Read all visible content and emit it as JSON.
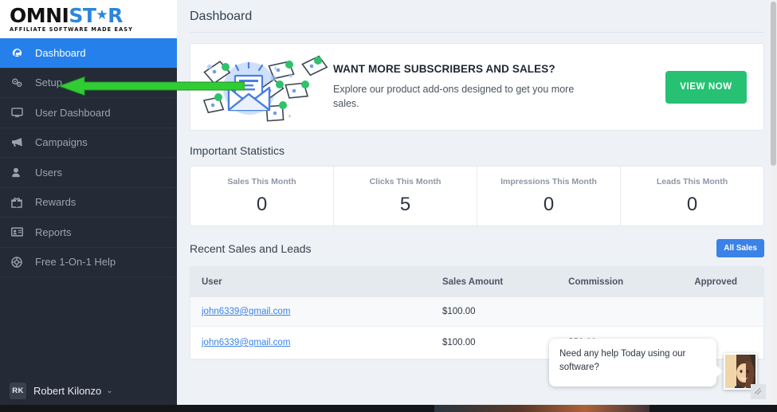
{
  "brand": {
    "logo_part1": "OMNI",
    "logo_part2": "ST",
    "logo_star": "★",
    "logo_part3": "R",
    "tagline": "AFFILIATE SOFTWARE MADE EASY"
  },
  "sidebar": {
    "items": [
      {
        "label": "Dashboard",
        "icon": "speedometer-icon",
        "active": true
      },
      {
        "label": "Setup",
        "icon": "gears-icon",
        "active": false
      },
      {
        "label": "User Dashboard",
        "icon": "monitor-icon",
        "active": false
      },
      {
        "label": "Campaigns",
        "icon": "megaphone-icon",
        "active": false
      },
      {
        "label": "Users",
        "icon": "user-icon",
        "active": false
      },
      {
        "label": "Rewards",
        "icon": "gift-icon",
        "active": false
      },
      {
        "label": "Reports",
        "icon": "id-card-icon",
        "active": false
      },
      {
        "label": "Free 1-On-1 Help",
        "icon": "lifebuoy-icon",
        "active": false
      }
    ],
    "user": {
      "initials": "RK",
      "name": "Robert Kilonzo",
      "caret": "⌄"
    },
    "active_color": "#2680eb",
    "background_color": "#242b37"
  },
  "header": {
    "page_title": "Dashboard"
  },
  "banner": {
    "headline": "WANT MORE SUBSCRIBERS AND SALES?",
    "subtext": "Explore our product add-ons designed to get you more sales.",
    "cta_label": "VIEW NOW",
    "cta_color": "#27c174",
    "illustration": "open-envelope-with-flying-letters-illustration"
  },
  "statistics": {
    "section_title": "Important Statistics",
    "cards": [
      {
        "label": "Sales This Month",
        "value": "0"
      },
      {
        "label": "Clicks This Month",
        "value": "5"
      },
      {
        "label": "Impressions This Month",
        "value": "0"
      },
      {
        "label": "Leads This Month",
        "value": "0"
      }
    ]
  },
  "recent": {
    "section_title": "Recent Sales and Leads",
    "all_sales_label": "All Sales",
    "all_sales_color": "#3b82e8",
    "columns": [
      "User",
      "Sales Amount",
      "Commission",
      "Approved"
    ],
    "rows": [
      {
        "user": "john6339@gmail.com",
        "amount": "$100.00",
        "commission": "",
        "approved": ""
      },
      {
        "user": "john6339@gmail.com",
        "amount": "$100.00",
        "commission": "$50.00",
        "approved": "✔"
      }
    ]
  },
  "chat": {
    "message": "Need any help Today using our software?",
    "agent_avatar": "smiling-woman-photo"
  },
  "annotation": {
    "arrow": "green-left-arrow-pointing-to-setup",
    "arrow_color": "#31cc34"
  }
}
